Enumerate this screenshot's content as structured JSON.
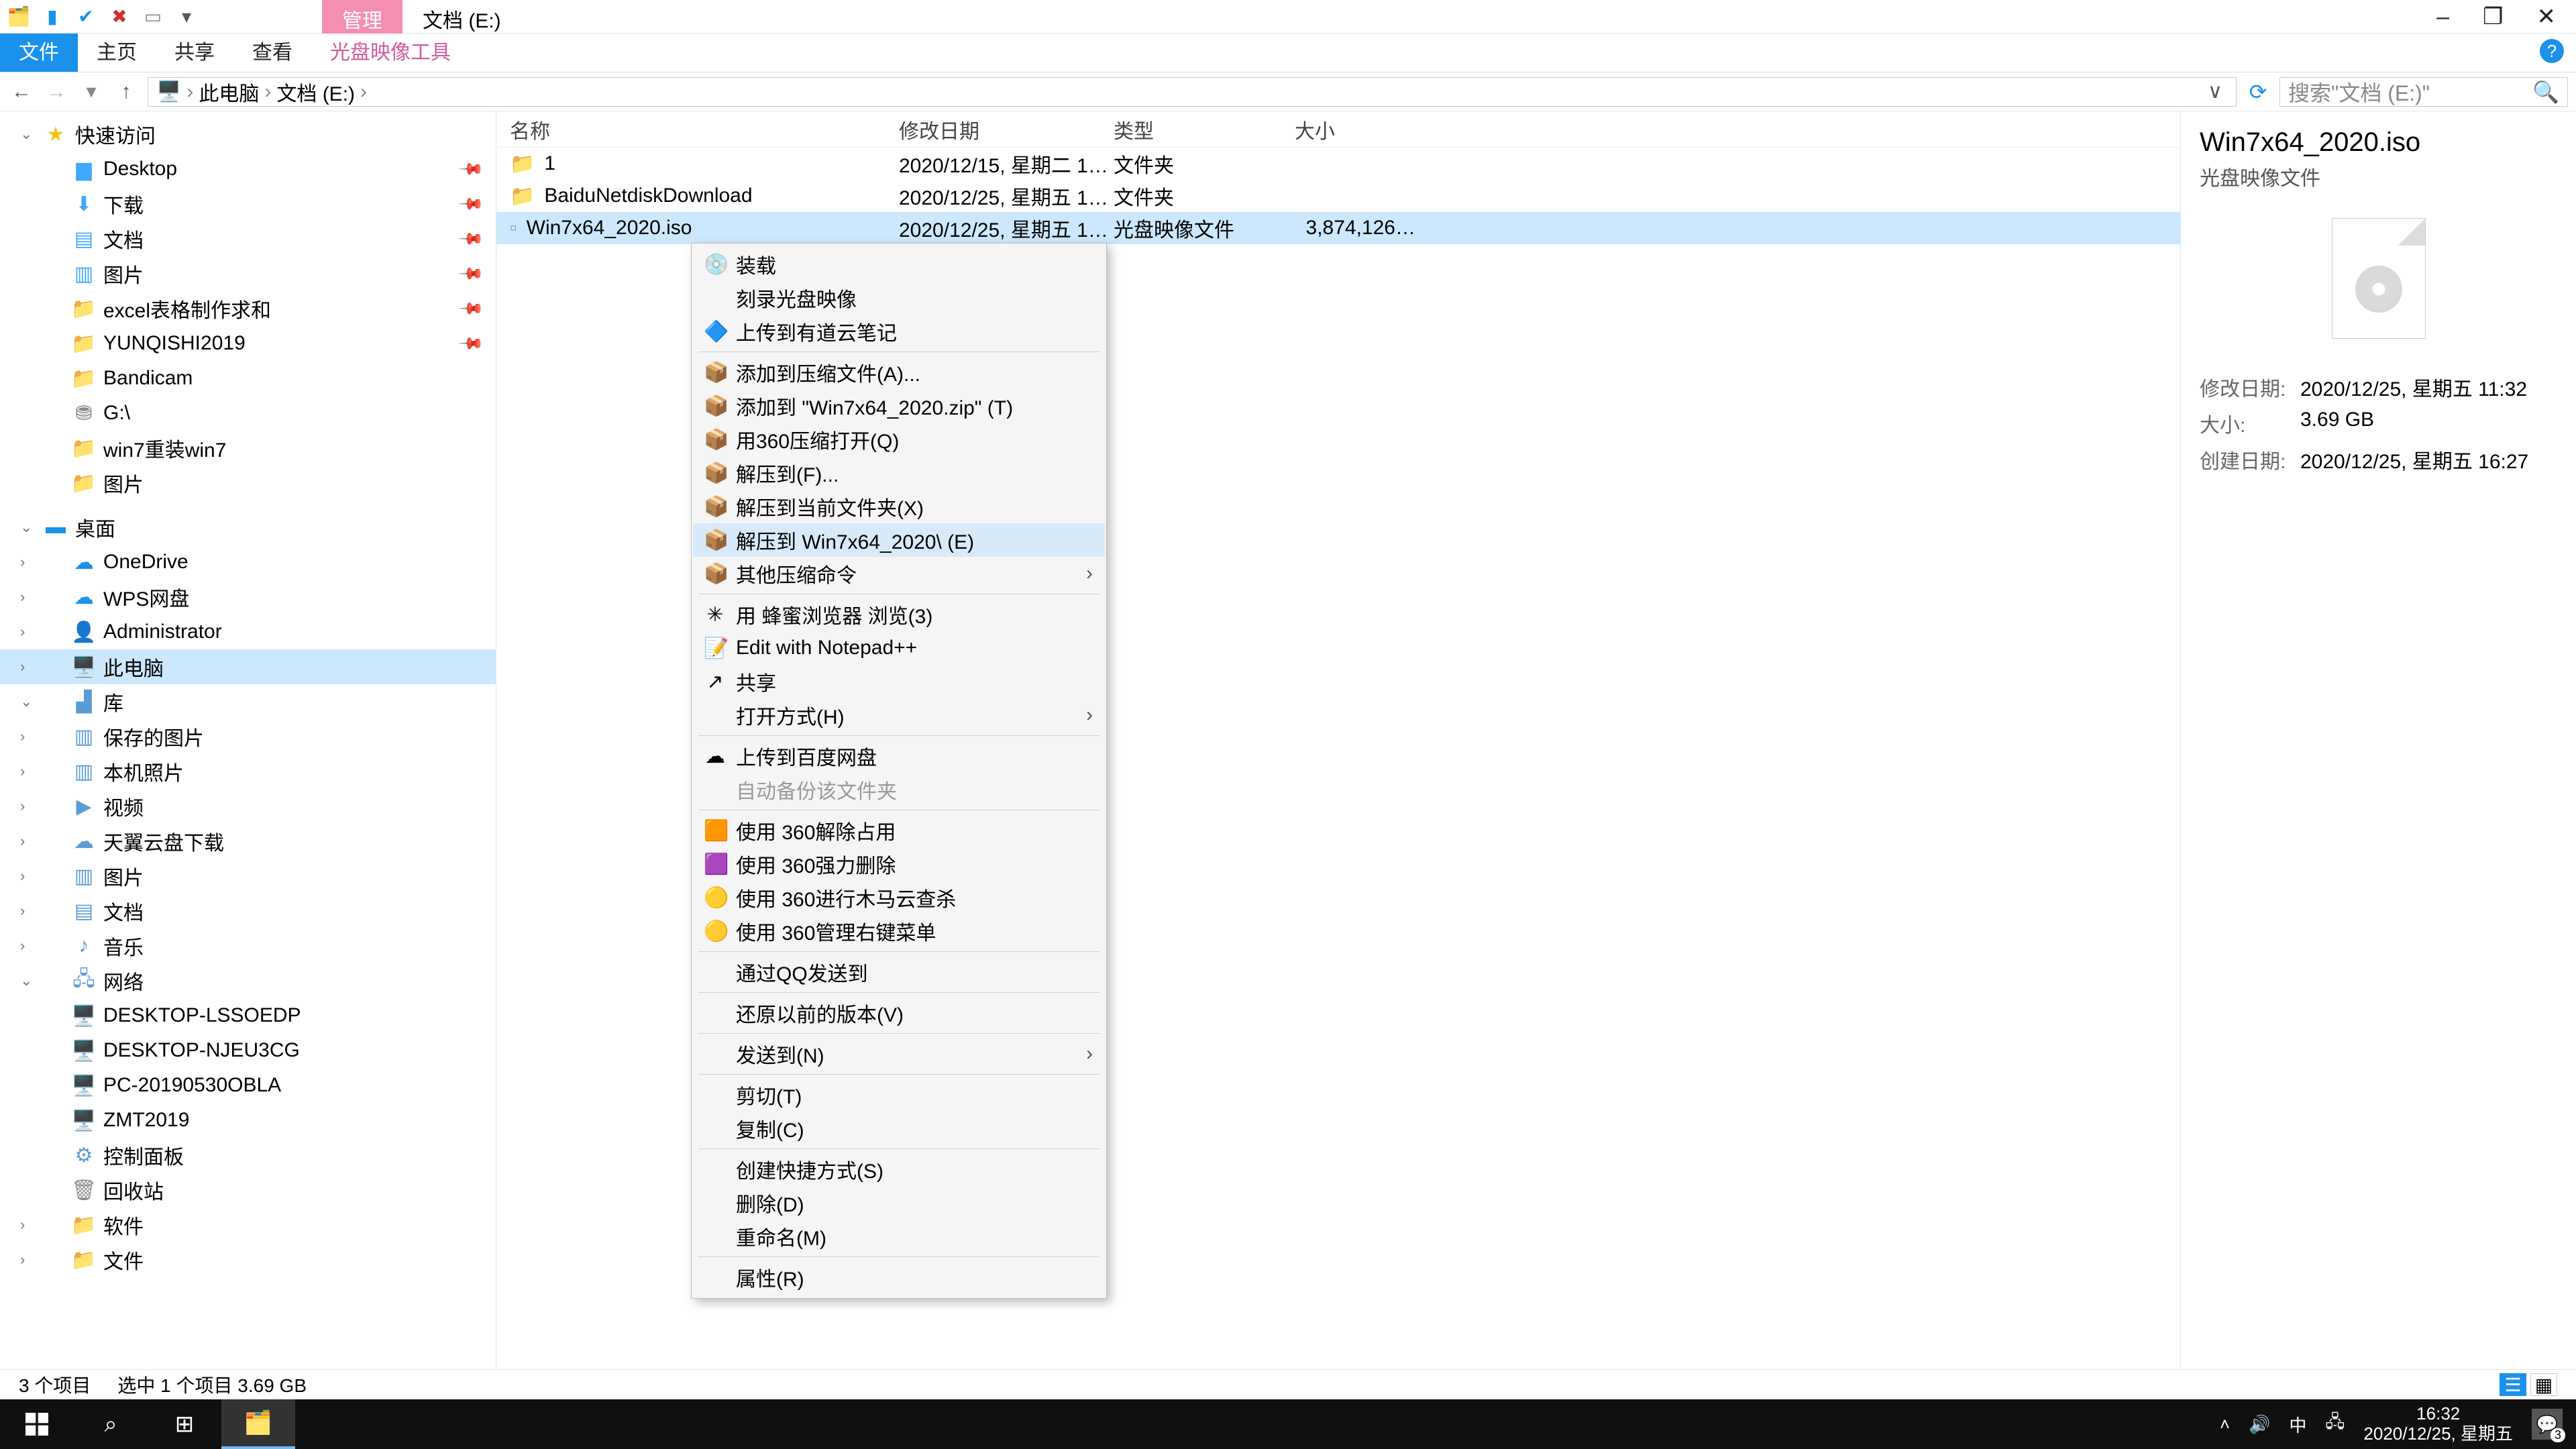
{
  "window": {
    "title_tab_active": "管理",
    "title_tab2": "文档 (E:)",
    "ribbon": [
      "文件",
      "主页",
      "共享",
      "查看",
      "光盘映像工具"
    ],
    "minimize": "–",
    "maximize": "❐",
    "close": "✕"
  },
  "address": {
    "back": "←",
    "fwd": "→",
    "up": "↑",
    "crumb1": "此电脑",
    "crumb2": "文档 (E:)",
    "sep": "›",
    "search_placeholder": "搜索\"文档 (E:)\""
  },
  "nav": {
    "quick": "快速访问",
    "items_quick": [
      "Desktop",
      "下载",
      "文档",
      "图片",
      "excel表格制作求和",
      "YUNQISHI2019",
      "Bandicam",
      "G:\\",
      "win7重装win7",
      "图片"
    ],
    "desktop": "桌面",
    "items_desktop": [
      "OneDrive",
      "WPS网盘",
      "Administrator",
      "此电脑",
      "库"
    ],
    "lib_items": [
      "保存的图片",
      "本机照片",
      "视频",
      "天翼云盘下载",
      "图片",
      "文档",
      "音乐"
    ],
    "network": "网络",
    "net_items": [
      "DESKTOP-LSSOEDP",
      "DESKTOP-NJEU3CG",
      "PC-20190530OBLA",
      "ZMT2019"
    ],
    "ctrl": "控制面板",
    "recycle": "回收站",
    "soft": "软件",
    "docs": "文件"
  },
  "cols": {
    "c1": "名称",
    "c2": "修改日期",
    "c3": "类型",
    "c4": "大小"
  },
  "rows": [
    {
      "name": "1",
      "date": "2020/12/15, 星期二 1…",
      "type": "文件夹",
      "size": "",
      "icon": "folder"
    },
    {
      "name": "BaiduNetdiskDownload",
      "date": "2020/12/25, 星期五 1…",
      "type": "文件夹",
      "size": "",
      "icon": "folder"
    },
    {
      "name": "Win7x64_2020.iso",
      "date": "2020/12/25, 星期五 1…",
      "type": "光盘映像文件",
      "size": "3,874,126…",
      "icon": "file",
      "sel": true
    }
  ],
  "ctx": [
    {
      "t": "装载",
      "ico": "💿"
    },
    {
      "t": "刻录光盘映像"
    },
    {
      "t": "上传到有道云笔记",
      "ico": "🔷"
    },
    {
      "hr": true
    },
    {
      "t": "添加到压缩文件(A)...",
      "ico": "📦"
    },
    {
      "t": "添加到 \"Win7x64_2020.zip\" (T)",
      "ico": "📦"
    },
    {
      "t": "用360压缩打开(Q)",
      "ico": "📦"
    },
    {
      "t": "解压到(F)...",
      "ico": "📦"
    },
    {
      "t": "解压到当前文件夹(X)",
      "ico": "📦"
    },
    {
      "t": "解压到 Win7x64_2020\\ (E)",
      "ico": "📦",
      "hl": true
    },
    {
      "t": "其他压缩命令",
      "ico": "📦",
      "sub": true
    },
    {
      "hr": true
    },
    {
      "t": "用 蜂蜜浏览器 浏览(3)",
      "ico": "✳"
    },
    {
      "t": "Edit with Notepad++",
      "ico": "📝"
    },
    {
      "t": "共享",
      "ico": "↗"
    },
    {
      "t": "打开方式(H)",
      "sub": true
    },
    {
      "hr": true
    },
    {
      "t": "上传到百度网盘",
      "ico": "☁"
    },
    {
      "t": "自动备份该文件夹",
      "dis": true
    },
    {
      "hr": true
    },
    {
      "t": "使用 360解除占用",
      "ico": "🟧"
    },
    {
      "t": "使用 360强力删除",
      "ico": "🟪"
    },
    {
      "t": "使用 360进行木马云查杀",
      "ico": "🟡"
    },
    {
      "t": "使用 360管理右键菜单",
      "ico": "🟡"
    },
    {
      "hr": true
    },
    {
      "t": "通过QQ发送到"
    },
    {
      "hr": true
    },
    {
      "t": "还原以前的版本(V)"
    },
    {
      "hr": true
    },
    {
      "t": "发送到(N)",
      "sub": true
    },
    {
      "hr": true
    },
    {
      "t": "剪切(T)"
    },
    {
      "t": "复制(C)"
    },
    {
      "hr": true
    },
    {
      "t": "创建快捷方式(S)"
    },
    {
      "t": "删除(D)"
    },
    {
      "t": "重命名(M)"
    },
    {
      "hr": true
    },
    {
      "t": "属性(R)"
    }
  ],
  "details": {
    "title": "Win7x64_2020.iso",
    "sub": "光盘映像文件",
    "m1k": "修改日期:",
    "m1v": "2020/12/25, 星期五 11:32",
    "m2k": "大小:",
    "m2v": "3.69 GB",
    "m3k": "创建日期:",
    "m3v": "2020/12/25, 星期五 16:27"
  },
  "status": {
    "a": "3 个项目",
    "b": "选中 1 个项目  3.69 GB"
  },
  "taskbar": {
    "time": "16:32",
    "date": "2020/12/25, 星期五",
    "badge": "3",
    "ime": "中"
  }
}
